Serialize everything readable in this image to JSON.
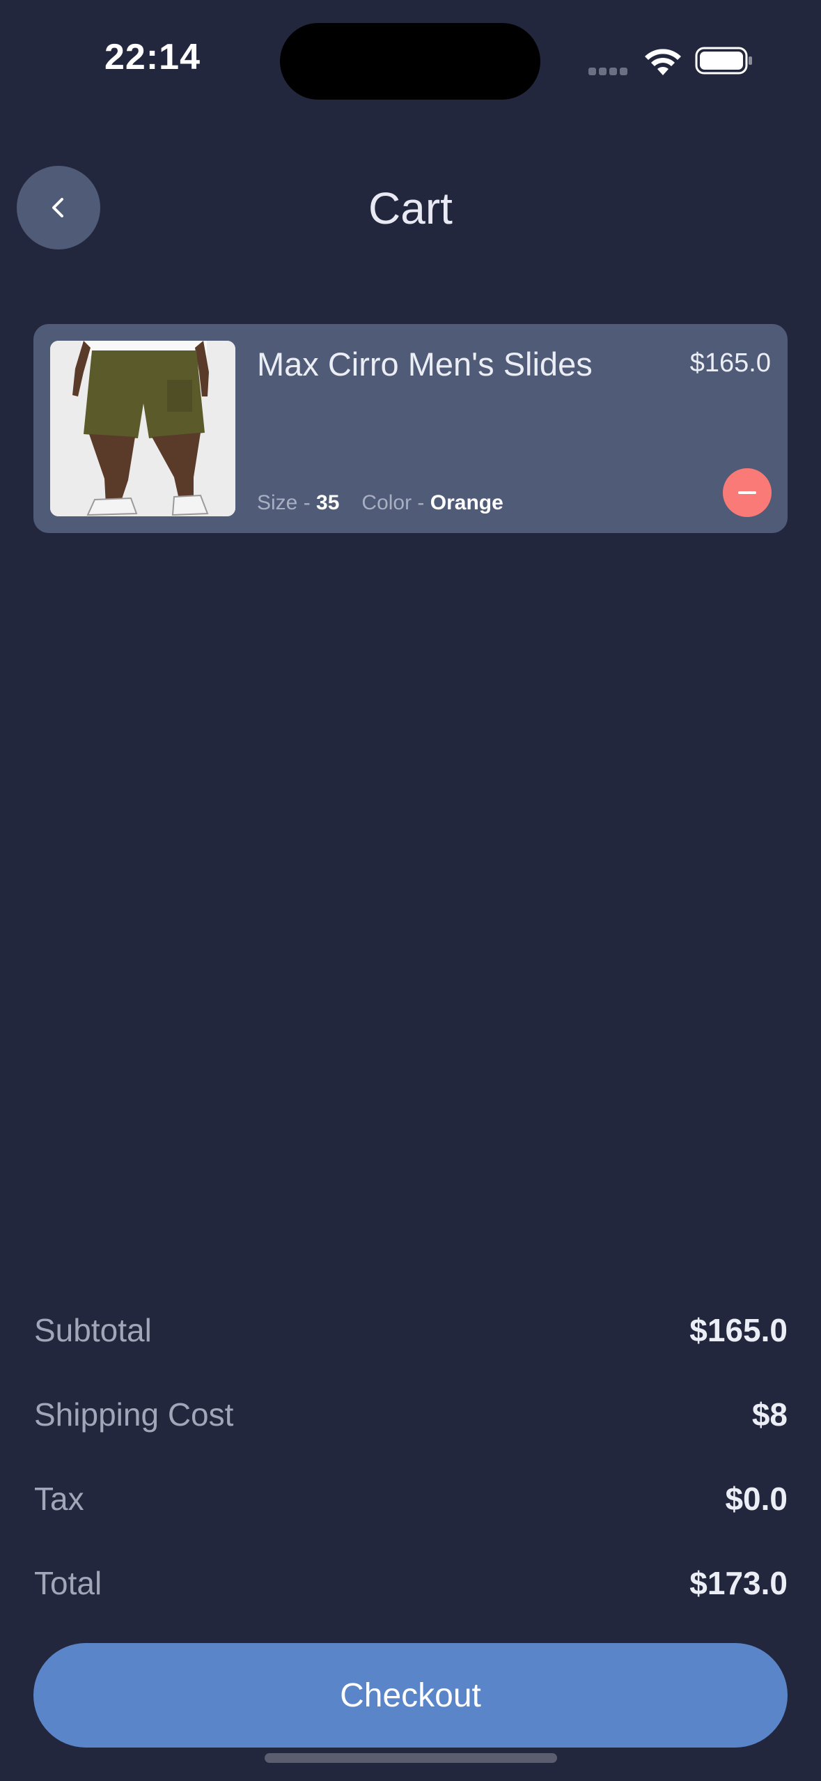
{
  "status_bar": {
    "time": "22:14"
  },
  "header": {
    "title": "Cart",
    "back_icon": "chevron-left-icon"
  },
  "cart": {
    "items": [
      {
        "name": "Max Cirro Men's Slides",
        "price": "$165.0",
        "size_label": "Size - ",
        "size_value": "35",
        "color_label": "Color - ",
        "color_value": "Orange",
        "remove_icon": "minus-icon"
      }
    ]
  },
  "summary": {
    "subtotal_label": "Subtotal",
    "subtotal_value": "$165.0",
    "shipping_label": "Shipping Cost",
    "shipping_value": "$8",
    "tax_label": "Tax",
    "tax_value": "$0.0",
    "total_label": "Total",
    "total_value": "$173.0"
  },
  "checkout": {
    "label": "Checkout"
  },
  "colors": {
    "background": "#23273e",
    "card": "#4f5b77",
    "accent": "#5a86c9",
    "remove": "#fa7a78"
  }
}
